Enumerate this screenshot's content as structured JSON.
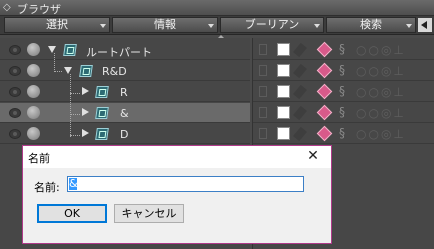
{
  "panel": {
    "title": "ブラウザ",
    "title_icon": "diamond-collapse-icon"
  },
  "menu": {
    "tabs": [
      {
        "label": "選択"
      },
      {
        "label": "情報"
      },
      {
        "label": "ブーリアン"
      },
      {
        "label": "検索"
      }
    ]
  },
  "tree": {
    "nodes": [
      {
        "label": "ルートパート",
        "expanded": true,
        "selected": false
      },
      {
        "label": "R&D",
        "expanded": true,
        "selected": false
      },
      {
        "label": "R",
        "expanded": false,
        "selected": false
      },
      {
        "label": "&",
        "expanded": false,
        "selected": true
      },
      {
        "label": "D",
        "expanded": false,
        "selected": false
      }
    ]
  },
  "dialog": {
    "title": "名前",
    "field_label": "名前:",
    "field_value": "&",
    "ok_label": "OK",
    "cancel_label": "キャンセル",
    "accent_color": "#b03a8a"
  },
  "colors": {
    "panel_bg": "#474747",
    "selected_row": "#6a6a6a",
    "node_icon": "#2d6b74",
    "material_diamond": "#d85a8a"
  }
}
